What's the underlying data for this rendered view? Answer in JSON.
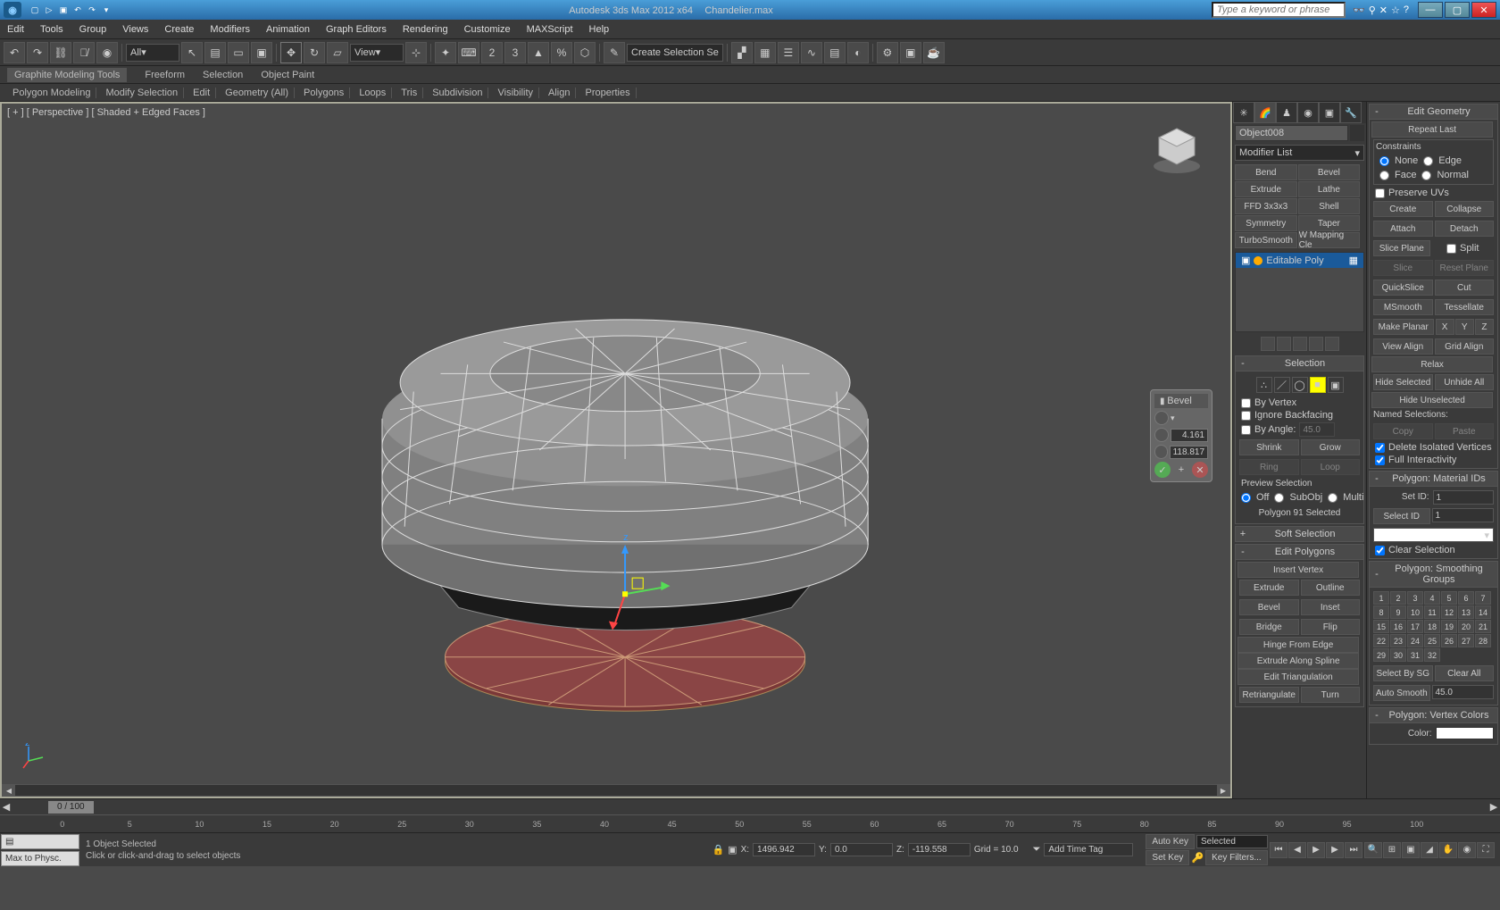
{
  "title": {
    "app": "Autodesk 3ds Max  2012 x64",
    "file": "Chandelier.max"
  },
  "search_placeholder": "Type a keyword or phrase",
  "menu": [
    "Edit",
    "Tools",
    "Group",
    "Views",
    "Create",
    "Modifiers",
    "Animation",
    "Graph Editors",
    "Rendering",
    "Customize",
    "MAXScript",
    "Help"
  ],
  "toolbar_select_all": "All",
  "toolbar_select_view": "View",
  "toolbar_create_sel": "Create Selection Se",
  "modeling_tabs": [
    "Graphite Modeling Tools",
    "Freeform",
    "Selection",
    "Object Paint"
  ],
  "submenu": [
    "Polygon Modeling",
    "Modify Selection",
    "Edit",
    "Geometry (All)",
    "Polygons",
    "Loops",
    "Tris",
    "Subdivision",
    "Visibility",
    "Align",
    "Properties"
  ],
  "viewport_label": "[ + ] [ Perspective ] [ Shaded + Edged Faces ]",
  "bevel": {
    "title": "Bevel",
    "height": "4.161",
    "outline": "118.817"
  },
  "object_name": "Object008",
  "modifier_list": "Modifier List",
  "modifier_buttons": [
    "Bend",
    "Bevel",
    "Extrude",
    "Lathe",
    "FFD 3x3x3",
    "Shell",
    "Symmetry",
    "Taper",
    "TurboSmooth",
    "W Mapping Cle"
  ],
  "stack_item": "Editable Poly",
  "rollouts": {
    "selection": "Selection",
    "soft_selection": "Soft Selection",
    "edit_polygons": "Edit Polygons",
    "edit_geometry": "Edit Geometry",
    "material_ids": "Polygon: Material IDs",
    "smoothing": "Polygon: Smoothing Groups",
    "vertex_colors": "Polygon: Vertex Colors"
  },
  "selection": {
    "by_vertex": "By Vertex",
    "ignore_backfacing": "Ignore Backfacing",
    "by_angle": "By Angle:",
    "angle_val": "45.0",
    "shrink": "Shrink",
    "grow": "Grow",
    "ring": "Ring",
    "loop": "Loop",
    "preview": "Preview Selection",
    "off": "Off",
    "subobj": "SubObj",
    "multi": "Multi",
    "status": "Polygon 91 Selected"
  },
  "edit_poly": {
    "insert_vertex": "Insert Vertex",
    "extrude": "Extrude",
    "outline": "Outline",
    "bevel": "Bevel",
    "inset": "Inset",
    "bridge": "Bridge",
    "flip": "Flip",
    "hinge": "Hinge From Edge",
    "extrude_spline": "Extrude Along Spline",
    "edit_tri": "Edit Triangulation",
    "retri": "Retriangulate",
    "turn": "Turn"
  },
  "edit_geom": {
    "repeat": "Repeat Last",
    "constraints": "Constraints",
    "none": "None",
    "edge": "Edge",
    "face": "Face",
    "normal": "Normal",
    "preserve_uvs": "Preserve UVs",
    "create": "Create",
    "collapse": "Collapse",
    "attach": "Attach",
    "detach": "Detach",
    "slice_plane": "Slice Plane",
    "split": "Split",
    "slice": "Slice",
    "reset_plane": "Reset Plane",
    "quickslice": "QuickSlice",
    "cut": "Cut",
    "msmooth": "MSmooth",
    "tessellate": "Tessellate",
    "make_planar": "Make Planar",
    "x": "X",
    "y": "Y",
    "z": "Z",
    "view_align": "View Align",
    "grid_align": "Grid Align",
    "relax": "Relax",
    "hide_sel": "Hide Selected",
    "unhide": "Unhide All",
    "hide_unsel": "Hide Unselected",
    "named_sel": "Named Selections:",
    "copy": "Copy",
    "paste": "Paste",
    "del_iso": "Delete Isolated Vertices",
    "full_int": "Full Interactivity"
  },
  "matid": {
    "set_id": "Set ID:",
    "set_val": "1",
    "select_id": "Select ID",
    "sel_val": "1",
    "clear_sel": "Clear Selection"
  },
  "smoothing": {
    "select_sg": "Select By SG",
    "clear_all": "Clear All",
    "auto": "Auto Smooth",
    "auto_val": "45.0"
  },
  "vcolor": {
    "color": "Color:"
  },
  "timeslider": "0 / 100",
  "status": {
    "selected": "1 Object Selected",
    "hint": "Click or click-and-drag to select objects",
    "x": "1496.942",
    "y": "0.0",
    "z": "-119.558",
    "grid": "Grid = 10.0",
    "add_time_tag": "Add Time Tag",
    "auto_key": "Auto Key",
    "set_key": "Set Key",
    "selected_filter": "Selected",
    "key_filters": "Key Filters..."
  },
  "max_to_physc": "Max to Physc."
}
